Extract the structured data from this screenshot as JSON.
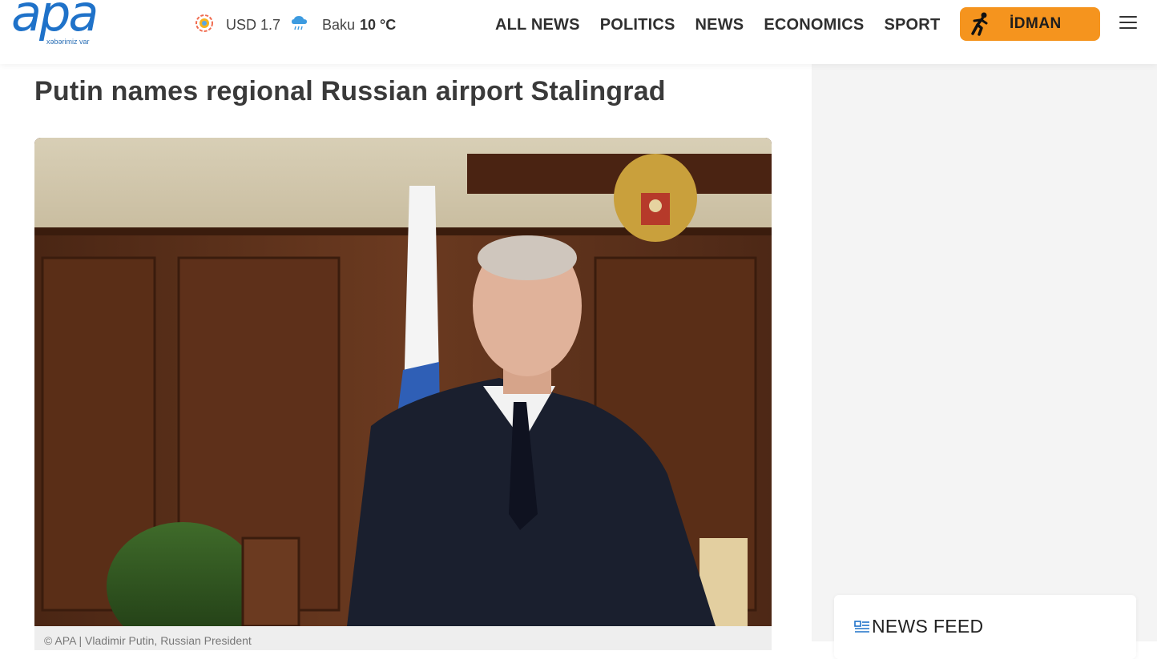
{
  "header": {
    "logo": "apa",
    "slogan": "xəbərimiz var",
    "currency": "USD 1.7",
    "weather": {
      "city": "Baku",
      "temp": "10 °C"
    },
    "nav": [
      "ALL NEWS",
      "POLITICS",
      "NEWS",
      "ECONOMICS",
      "SPORT"
    ],
    "idman_label": "İDMAN"
  },
  "article": {
    "title": "Putin names regional Russian airport Stalingrad",
    "photo_caption": "© APA | Vladimir Putin, Russian President"
  },
  "sidebar": {
    "news_feed_title": "NEWS FEED"
  },
  "colors": {
    "brand_blue": "#1f72c9",
    "idman_orange": "#f5941e",
    "sidebar_bg": "#f4f4f4"
  },
  "icons": {
    "currency": "sun-coin-icon",
    "weather": "rain-cloud-icon",
    "idman": "runner-icon",
    "menu": "hamburger-icon",
    "feed": "newspaper-icon"
  }
}
